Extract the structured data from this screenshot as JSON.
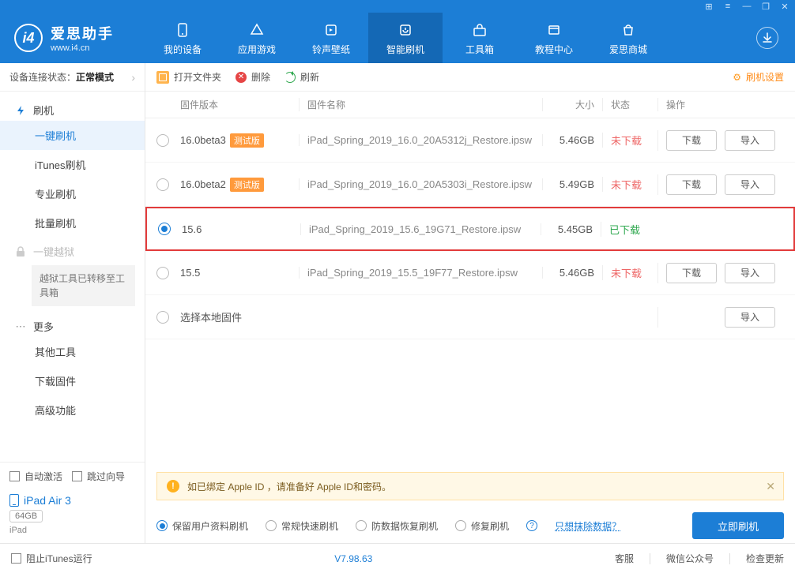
{
  "titlebar": {
    "icons": [
      "grid",
      "list",
      "min",
      "restore",
      "close"
    ]
  },
  "logo": {
    "name": "爱思助手",
    "url": "www.i4.cn"
  },
  "topTabs": [
    {
      "id": "device",
      "label": "我的设备"
    },
    {
      "id": "apps",
      "label": "应用游戏"
    },
    {
      "id": "ringtones",
      "label": "铃声壁纸"
    },
    {
      "id": "flash",
      "label": "智能刷机"
    },
    {
      "id": "toolbox",
      "label": "工具箱"
    },
    {
      "id": "tutorial",
      "label": "教程中心"
    },
    {
      "id": "store",
      "label": "爱思商城"
    }
  ],
  "activeTopTab": "flash",
  "sidebar": {
    "connLabel": "设备连接状态：",
    "connValue": "正常模式",
    "groupFlash": "刷机",
    "items": [
      {
        "id": "oneclick",
        "label": "一键刷机",
        "active": true
      },
      {
        "id": "itunes",
        "label": "iTunes刷机"
      },
      {
        "id": "pro",
        "label": "专业刷机"
      },
      {
        "id": "batch",
        "label": "批量刷机"
      }
    ],
    "groupJailbreak": "一键越狱",
    "jbNote": "越狱工具已转移至工具箱",
    "groupMore": "更多",
    "more": [
      {
        "label": "其他工具"
      },
      {
        "label": "下载固件"
      },
      {
        "label": "高级功能"
      }
    ],
    "autoActivate": "自动激活",
    "skipGuide": "跳过向导",
    "device": {
      "name": "iPad Air 3",
      "capacity": "64GB",
      "type": "iPad"
    }
  },
  "toolbar": {
    "open": "打开文件夹",
    "del": "删除",
    "refresh": "刷新",
    "settings": "刷机设置"
  },
  "columns": {
    "version": "固件版本",
    "name": "固件名称",
    "size": "大小",
    "status": "状态",
    "ops": "操作"
  },
  "badge": "测试版",
  "statusText": {
    "nd": "未下载",
    "dl": "已下载"
  },
  "buttons": {
    "download": "下载",
    "import": "导入"
  },
  "rows": [
    {
      "ver": "16.0beta3",
      "beta": true,
      "name": "iPad_Spring_2019_16.0_20A5312j_Restore.ipsw",
      "size": "5.46GB",
      "status": "nd",
      "sel": false,
      "hl": false,
      "showDl": true
    },
    {
      "ver": "16.0beta2",
      "beta": true,
      "name": "iPad_Spring_2019_16.0_20A5303i_Restore.ipsw",
      "size": "5.49GB",
      "status": "nd",
      "sel": false,
      "hl": false,
      "showDl": true
    },
    {
      "ver": "15.6",
      "beta": false,
      "name": "iPad_Spring_2019_15.6_19G71_Restore.ipsw",
      "size": "5.45GB",
      "status": "dl",
      "sel": true,
      "hl": true,
      "showDl": false
    },
    {
      "ver": "15.5",
      "beta": false,
      "name": "iPad_Spring_2019_15.5_19F77_Restore.ipsw",
      "size": "5.46GB",
      "status": "nd",
      "sel": false,
      "hl": false,
      "showDl": true
    }
  ],
  "localRow": "选择本地固件",
  "warning": "如已绑定 Apple ID ，请准备好 Apple ID和密码。",
  "options": [
    {
      "label": "保留用户资料刷机",
      "sel": true
    },
    {
      "label": "常规快速刷机",
      "sel": false
    },
    {
      "label": "防数据恢复刷机",
      "sel": false
    },
    {
      "label": "修复刷机",
      "sel": false
    }
  ],
  "eraseLink": "只想抹除数据？",
  "flashNow": "立即刷机",
  "footer": {
    "blockItunes": "阻止iTunes运行",
    "version": "V7.98.63",
    "support": "客服",
    "wechat": "微信公众号",
    "update": "检查更新"
  }
}
